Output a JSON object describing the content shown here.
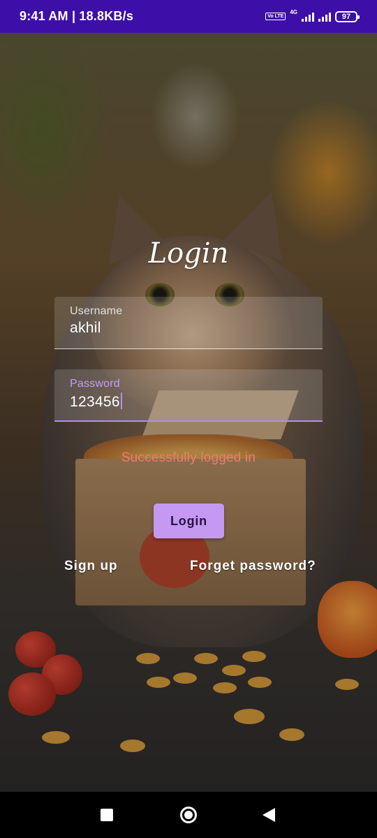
{
  "status_bar": {
    "time_speed": "9:41 AM | 18.8KB/s",
    "volte": "Vo LTE",
    "network": "4G",
    "battery": "97"
  },
  "login": {
    "title": "Login",
    "username_label": "Username",
    "username_value": "akhil",
    "password_label": "Password",
    "password_value": "123456",
    "message": "Successfully logged in",
    "login_button": "Login",
    "signup_link": "Sign up",
    "forget_link": "Forget password?"
  },
  "colors": {
    "status_bar": "#3d0fa8",
    "accent": "#c598f2",
    "message": "#f07a72"
  },
  "icons": {
    "recents": "square-icon",
    "home": "circle-icon",
    "back": "triangle-back-icon"
  }
}
